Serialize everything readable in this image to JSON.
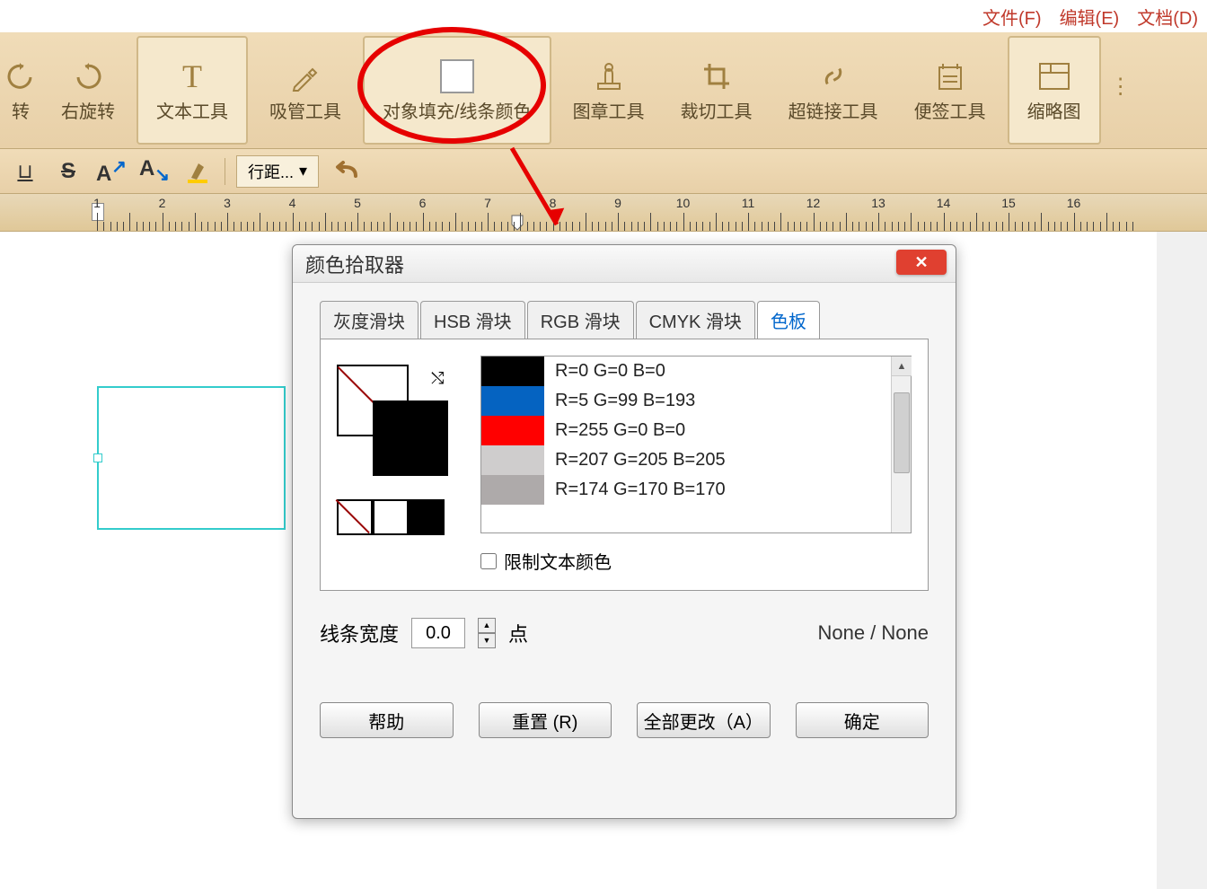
{
  "menubar": {
    "file": "文件(F)",
    "edit": "编辑(E)",
    "document": "文档(D)"
  },
  "toolbar": {
    "rotate_left_suffix": "转",
    "rotate_right": "右旋转",
    "text_tool": "文本工具",
    "eyedropper": "吸管工具",
    "fill_line_color": "对象填充/线条颜色",
    "stamp": "图章工具",
    "crop": "裁切工具",
    "hyperlink": "超链接工具",
    "note": "便签工具",
    "thumbnail": "缩略图"
  },
  "sub_toolbar": {
    "line_spacing": "行距..."
  },
  "ruler": {
    "numbers": [
      1,
      2,
      3,
      4,
      5,
      6,
      7,
      8,
      9,
      10,
      11,
      12,
      13,
      14,
      15,
      16
    ]
  },
  "dialog": {
    "title": "颜色拾取器",
    "tabs": {
      "gray": "灰度滑块",
      "hsb": "HSB 滑块",
      "rgb": "RGB 滑块",
      "cmyk": "CMYK 滑块",
      "palette": "色板"
    },
    "colors": [
      {
        "hex": "#000000",
        "label": "R=0 G=0 B=0"
      },
      {
        "hex": "#0563c1",
        "label": "R=5 G=99 B=193"
      },
      {
        "hex": "#ff0000",
        "label": "R=255 G=0 B=0"
      },
      {
        "hex": "#cfcdcd",
        "label": "R=207 G=205 B=205"
      },
      {
        "hex": "#aeaaaa",
        "label": "R=174 G=170 B=170"
      }
    ],
    "limit_text_color": "限制文本颜色",
    "line_width_label": "线条宽度",
    "line_width_value": "0.0",
    "point_label": "点",
    "none_none": "None / None",
    "buttons": {
      "help": "帮助",
      "reset": "重置 (R)",
      "change_all": "全部更改（A）",
      "ok": "确定"
    }
  }
}
